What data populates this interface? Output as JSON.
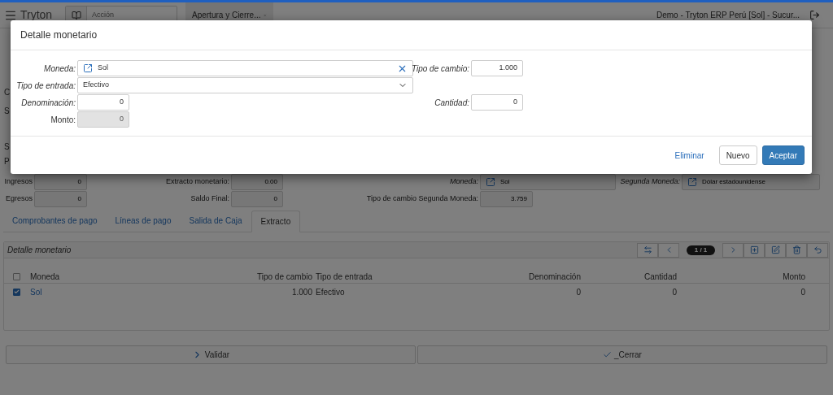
{
  "header": {
    "app_title": "Tryton",
    "search": {
      "placeholder": "Acción"
    },
    "tabs": [
      {
        "label": "Apertura y Cierre..."
      }
    ],
    "context": "Demo - Tryton ERP Perú [Sol] - Sucur..."
  },
  "form": {
    "left_fragments": [
      "C",
      "S",
      "S",
      "P"
    ],
    "rows": [
      [
        {
          "label": "Ingresos",
          "value": "0",
          "kind": "number",
          "required": false
        },
        {
          "label": "Extracto monetario:",
          "value": "0.00",
          "kind": "number",
          "required": false
        },
        {
          "label": "Moneda:",
          "value": "Sol",
          "kind": "link",
          "required": true
        },
        {
          "label": "Segunda Moneda:",
          "value": "Dólar estadounidense",
          "kind": "link",
          "required": true
        }
      ],
      [
        {
          "label": "Egresos",
          "value": "0",
          "kind": "number",
          "required": false
        },
        {
          "label": "Saldo Final:",
          "value": "0",
          "kind": "number",
          "required": false
        },
        {
          "label": "Tipo de cambio Segunda Moneda:",
          "value": "3.759",
          "kind": "number",
          "required": false
        }
      ]
    ]
  },
  "tabs": [
    {
      "label": "Comprobantes de pago",
      "selected": false
    },
    {
      "label": "Líneas de pago",
      "selected": false
    },
    {
      "label": "Salida de Caja",
      "selected": false
    },
    {
      "label": "Extracto",
      "selected": true
    }
  ],
  "panel": {
    "title": "Detalle monetario",
    "pager": "1 / 1",
    "all_selected": false,
    "columns": [
      {
        "label": "Moneda"
      },
      {
        "label": "Tipo de cambio"
      },
      {
        "label": "Tipo de entrada"
      },
      {
        "label": "Denominación"
      },
      {
        "label": "Cantidad"
      },
      {
        "label": "Monto"
      }
    ],
    "rows": [
      {
        "selected": true,
        "cells": [
          "Sol",
          "1.000",
          "Efectivo",
          "0",
          "0",
          "0"
        ]
      }
    ]
  },
  "buttons": [
    {
      "label": "Validar",
      "kind": "next"
    },
    {
      "label": "_Cerrar",
      "kind": "check"
    }
  ],
  "dialog": {
    "title": "Detalle monetario",
    "fields": [
      {
        "label": "Moneda:",
        "kind": "link",
        "value": "Sol",
        "required": true,
        "readonly": false
      },
      {
        "label": "Tipo de cambio:",
        "kind": "number",
        "value": "1.000",
        "required": true,
        "readonly": false
      },
      {
        "label": "Tipo de entrada:",
        "kind": "select",
        "value": "Efectivo",
        "required": true,
        "readonly": false
      },
      {
        "label": "Denominación:",
        "kind": "number",
        "value": "0",
        "required": true,
        "readonly": false
      },
      {
        "label": "Cantidad:",
        "kind": "number",
        "value": "0",
        "required": true,
        "readonly": false
      },
      {
        "label": "Monto:",
        "kind": "number",
        "value": "0",
        "required": false,
        "readonly": true
      }
    ],
    "actions": [
      {
        "label": "Eliminar",
        "kind": "link"
      },
      {
        "label": "Nuevo",
        "kind": "default"
      },
      {
        "label": "Aceptar",
        "kind": "primary"
      }
    ]
  }
}
